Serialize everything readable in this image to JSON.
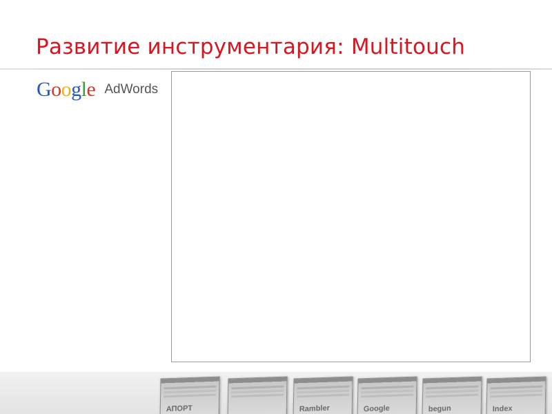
{
  "slide": {
    "title": "Развитие инструментария: Multitouch"
  },
  "logo": {
    "letters": [
      {
        "char": "G",
        "color": "#2a55c7"
      },
      {
        "char": "o",
        "color": "#d8352a"
      },
      {
        "char": "o",
        "color": "#e9b413"
      },
      {
        "char": "g",
        "color": "#2a55c7"
      },
      {
        "char": "l",
        "color": "#3a9b3a"
      },
      {
        "char": "e",
        "color": "#d8352a"
      }
    ],
    "product": "AdWords"
  },
  "footer": {
    "thumbnails": [
      {
        "label": "АПОРТ"
      },
      {
        "label": ""
      },
      {
        "label": "Rambler"
      },
      {
        "label": "Google"
      },
      {
        "label": "begun"
      },
      {
        "label": "Index"
      }
    ]
  },
  "colors": {
    "title": "#d7171f",
    "frame_border": "#9a9a9a"
  }
}
